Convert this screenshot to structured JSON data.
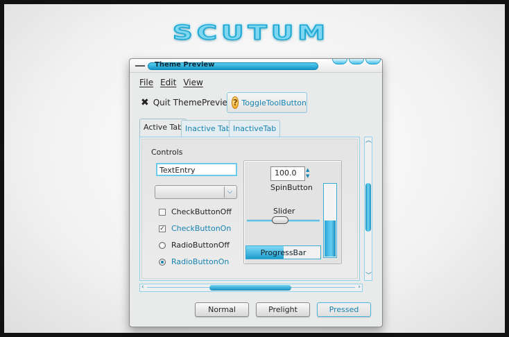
{
  "logo": {
    "text": "SCUTUM"
  },
  "window": {
    "title": "Theme Preview"
  },
  "menu": [
    "File",
    "Edit",
    "View"
  ],
  "toolbar": {
    "quit_label": "Quit ThemePreview!",
    "toggle_label": "ToggleToolButton"
  },
  "tabs": [
    "Active Tab",
    "Inactive Tab",
    "InactiveTab"
  ],
  "controls": {
    "frame_label": "Controls",
    "text_entry_value": "TextEntry",
    "combo_value": "",
    "checks": [
      {
        "label": "CheckButtonOff",
        "checked": false
      },
      {
        "label": "CheckButtonOn",
        "checked": true
      }
    ],
    "radios": [
      {
        "label": "RadioButtonOff",
        "selected": false
      },
      {
        "label": "RadioButtonOn",
        "selected": true
      }
    ],
    "spin_value": "100.0",
    "spin_label": "SpinButton",
    "slider_label": "Slider",
    "slider_fraction": 0.45,
    "vprogress_fraction": 0.5,
    "progress_label": "ProgressBar",
    "progress_fraction": 0.5
  },
  "buttons": {
    "normal": "Normal",
    "prelight": "Prelight",
    "pressed": "Pressed"
  },
  "colors": {
    "accent": "#1683b0",
    "highlight": "#6ccbeb"
  }
}
